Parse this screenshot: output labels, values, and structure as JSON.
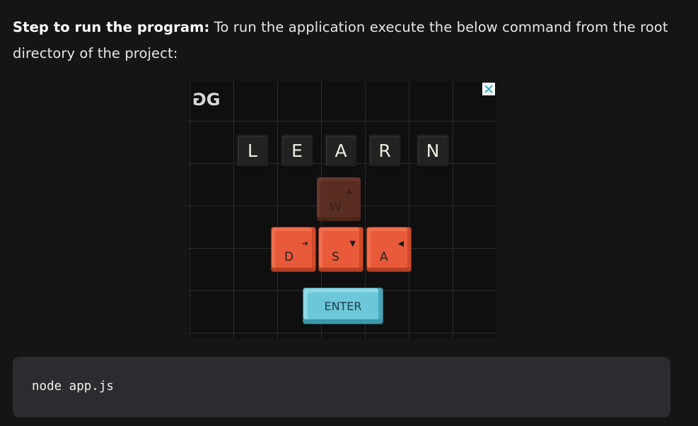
{
  "step": {
    "label": "Step to run the program:",
    "text": " To run the application execute the below command from the root directory of the project:"
  },
  "ad": {
    "logo": "GG",
    "close_icon": "close-x-icon",
    "learn_keys": [
      "L",
      "E",
      "A",
      "R",
      "N"
    ],
    "keys": {
      "w": "W",
      "d": "D",
      "s": "S",
      "a": "A",
      "enter": "ENTER"
    },
    "colors": {
      "orange_key": "#e85a39",
      "enter_key": "#6cc7d8",
      "close_icon": "#1aa3c6"
    }
  },
  "code": {
    "command": "node app.js"
  }
}
